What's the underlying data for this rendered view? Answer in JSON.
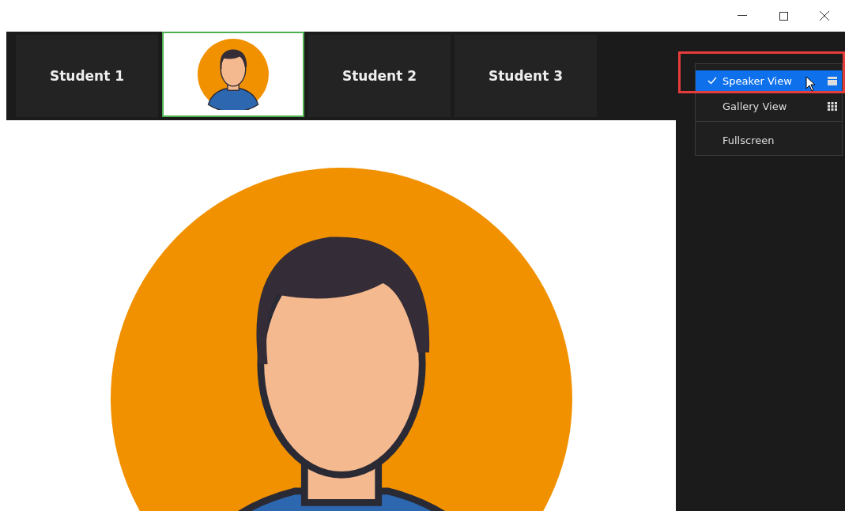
{
  "thumbnails": [
    {
      "kind": "name",
      "label": "Student 1",
      "active": false
    },
    {
      "kind": "avatar",
      "active": true
    },
    {
      "kind": "name",
      "label": "Student 2",
      "active": false
    },
    {
      "kind": "name",
      "label": "Student 3",
      "active": false
    }
  ],
  "view_menu": {
    "items": [
      {
        "kind": "view",
        "label": "Speaker View",
        "checked": true,
        "selected": true
      },
      {
        "kind": "view",
        "label": "Gallery View",
        "checked": false,
        "selected": false
      },
      {
        "kind": "action",
        "label": "Fullscreen",
        "checked": false,
        "selected": false
      }
    ]
  },
  "main_video": {
    "kind": "avatar"
  }
}
